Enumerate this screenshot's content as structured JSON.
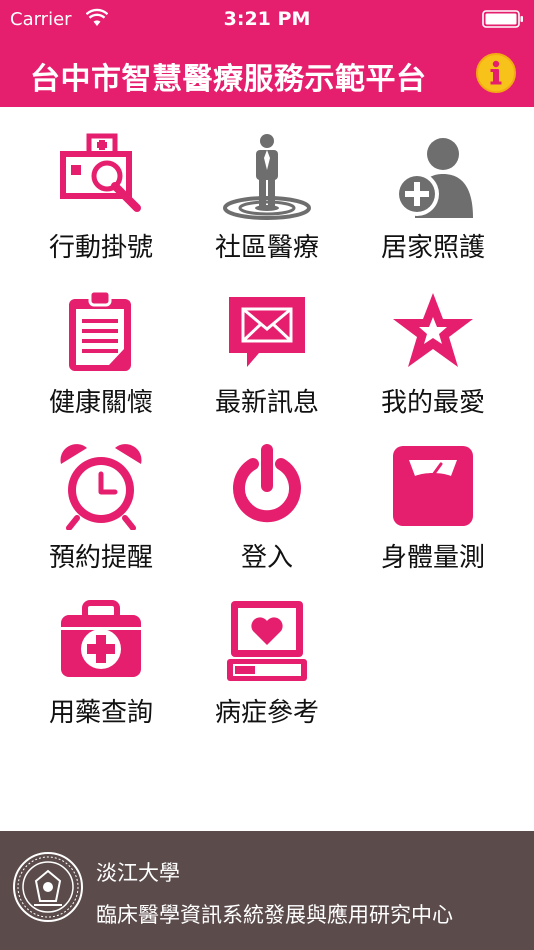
{
  "status_bar": {
    "carrier": "Carrier",
    "time": "3:21 PM"
  },
  "header": {
    "title": "台中市智慧醫療服務示範平台"
  },
  "grid": {
    "items": [
      {
        "label": "行動掛號",
        "icon": "hospital-search-icon"
      },
      {
        "label": "社區醫療",
        "icon": "person-target-icon"
      },
      {
        "label": "居家照護",
        "icon": "person-add-icon"
      },
      {
        "label": "健康關懷",
        "icon": "clipboard-icon"
      },
      {
        "label": "最新訊息",
        "icon": "mail-bubble-icon"
      },
      {
        "label": "我的最愛",
        "icon": "star-icon"
      },
      {
        "label": "預約提醒",
        "icon": "alarm-clock-icon"
      },
      {
        "label": "登入",
        "icon": "power-icon"
      },
      {
        "label": "身體量測",
        "icon": "scale-icon"
      },
      {
        "label": "用藥查詢",
        "icon": "medical-kit-icon"
      },
      {
        "label": "病症參考",
        "icon": "heart-monitor-icon"
      }
    ]
  },
  "footer": {
    "line1": "淡江大學",
    "line2": "臨床醫學資訊系統發展與應用研究中心"
  },
  "colors": {
    "primary": "#e61e6e",
    "footer_bg": "#5b4b4b",
    "info": "#f7c21a",
    "gray_icon": "#6e6e6e"
  }
}
